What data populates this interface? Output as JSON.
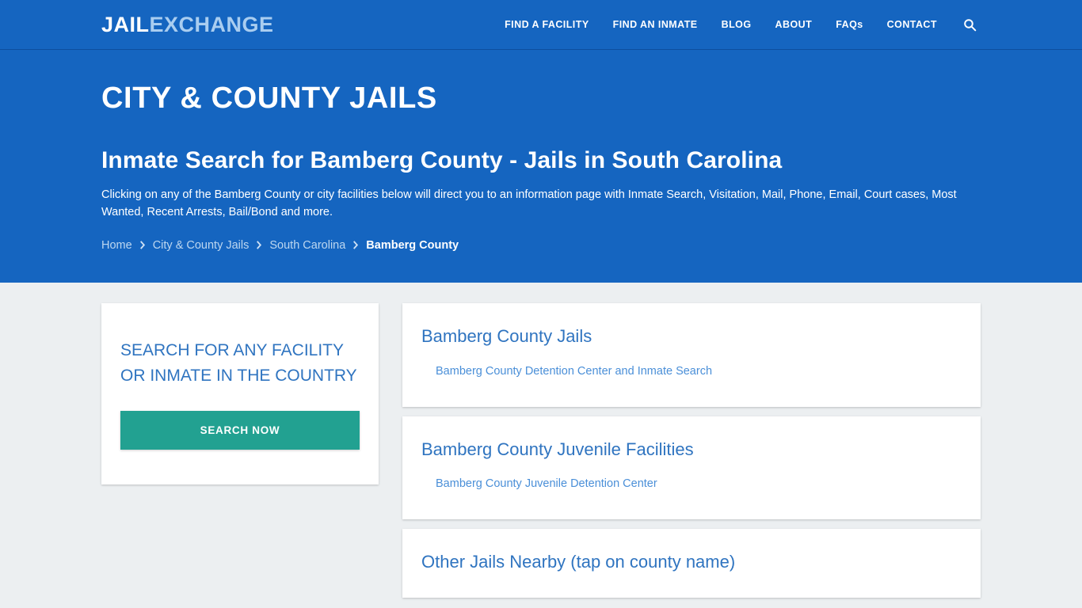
{
  "header": {
    "logo": {
      "part1": "JAIL",
      "part2": "EXCHANGE"
    },
    "nav": [
      {
        "label": "FIND A FACILITY"
      },
      {
        "label": "FIND AN INMATE"
      },
      {
        "label": "BLOG"
      },
      {
        "label": "ABOUT"
      },
      {
        "label": "FAQs"
      },
      {
        "label": "CONTACT"
      }
    ],
    "search_icon": "search-icon"
  },
  "hero": {
    "kicker": "CITY & COUNTY JAILS",
    "title": "Inmate Search for Bamberg County - Jails in South Carolina",
    "description": "Clicking on any of the Bamberg County or city facilities below will direct you to an information page with Inmate Search, Visitation, Mail, Phone, Email, Court cases, Most Wanted, Recent Arrests, Bail/Bond and more.",
    "breadcrumb": [
      {
        "label": "Home",
        "current": false
      },
      {
        "label": "City & County Jails",
        "current": false
      },
      {
        "label": "South Carolina",
        "current": false
      },
      {
        "label": "Bamberg County",
        "current": true
      }
    ]
  },
  "sidebar": {
    "card_title": "SEARCH FOR ANY FACILITY OR INMATE IN THE COUNTRY",
    "button_label": "SEARCH NOW"
  },
  "content": {
    "cards": [
      {
        "title": "Bamberg County Jails",
        "links": [
          {
            "label": "Bamberg County Detention Center and Inmate Search"
          }
        ]
      },
      {
        "title": "Bamberg County Juvenile Facilities",
        "links": [
          {
            "label": "Bamberg County Juvenile Detention Center"
          }
        ]
      },
      {
        "title": "Other Jails Nearby (tap on county name)",
        "links": []
      }
    ]
  },
  "colors": {
    "brand_blue": "#1565c0",
    "link_blue": "#4a8fd8",
    "heading_blue": "#2f74c0",
    "accent_green": "#22a191",
    "page_bg": "#eceff1"
  }
}
